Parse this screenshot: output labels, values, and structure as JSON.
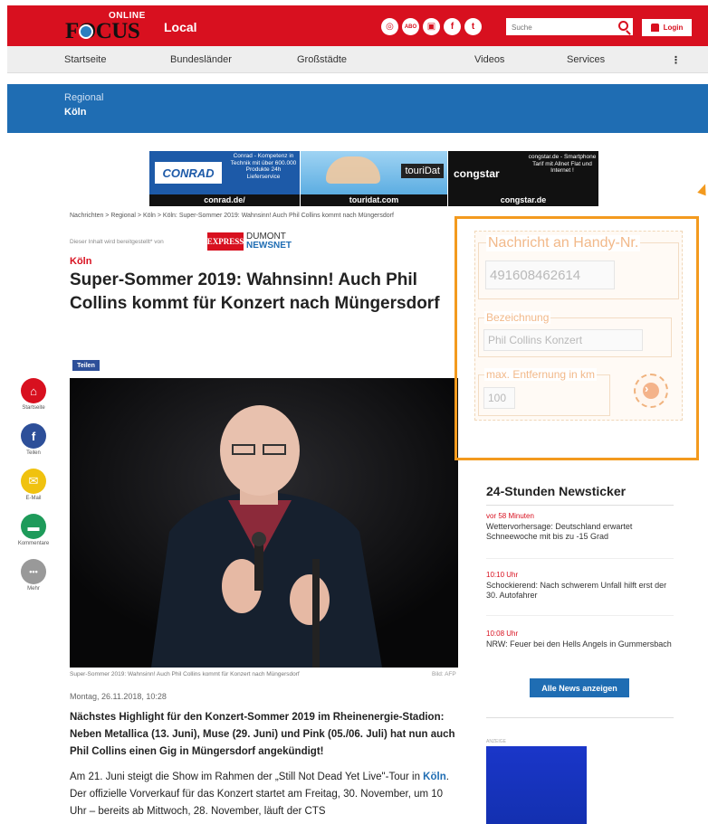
{
  "header": {
    "logo_top": "ONLINE",
    "logo_main": "FOCUS",
    "section": "Local",
    "social_icons": [
      "globe-icon",
      "abo-icon",
      "podcast-icon",
      "facebook-icon",
      "twitter-icon"
    ],
    "abo_label": "ABO",
    "search_placeholder": "Suche",
    "login_label": "Login"
  },
  "nav": {
    "items": [
      "Startseite",
      "Bundesländer",
      "Großstädte",
      "Videos",
      "Services"
    ],
    "more": "⋮"
  },
  "regional": {
    "kicker": "Regional",
    "city": "Köln"
  },
  "ads": {
    "conrad_logo": "CONRAD",
    "conrad_text": "Conrad - Kompetenz in Technik mit über 600.000 Produkte 24h Lieferservice",
    "conrad_url": "conrad.de/",
    "touri_logo": "touriDat",
    "touri_url": "touridat.com",
    "congstar_logo": "congstar",
    "congstar_text": "congstar.de - Smartphone Tarif mit Allnet Flat und Internet !",
    "congstar_url": "congstar.de"
  },
  "article": {
    "breadcrumb": "Nachrichten  >  Regional  >  Köln  >  Köln: Super-Sommer 2019: Wahnsinn! Auch Phil Collins kommt nach Müngersdorf",
    "provider_text": "Dieser Inhalt wird bereitgestellt* von",
    "provider_logo": "EXPRESS",
    "provider_brand_1": "DUMONT",
    "provider_brand_2": "NEWSNET",
    "kicker": "Köln",
    "headline": "Super-Sommer 2019: Wahnsinn! Auch Phil Collins kommt für Konzert nach Müngersdorf",
    "share_label": "Teilen",
    "caption": "Super-Sommer 2019: Wahnsinn! Auch Phil Collins kommt für Konzert nach Müngersdorf",
    "credit": "Bild: AFP",
    "date": "Montag, 26.11.2018, 10:28",
    "lead": "Nächstes Highlight für den Konzert-Sommer 2019 im Rheinenergie-Stadion: Neben Metallica (13. Juni), Muse (29. Juni) und Pink (05./06. Juli) hat nun auch Phil Collins einen Gig in Müngersdorf angekündigt!",
    "body_1": "Am 21. Juni steigt die Show im Rahmen der „Still Not Dead Yet Live\"-Tour in ",
    "body_link": "Köln",
    "body_2": ". Der offizielle Vorverkauf für das Konzert startet am Freitag, 30. November, um 10 Uhr – bereits ab Mittwoch, 28. November, läuft der CTS"
  },
  "rail": [
    {
      "icon": "home-icon",
      "label": "Startseite",
      "color": "#d8101f",
      "glyph": "⌂"
    },
    {
      "icon": "facebook-icon",
      "label": "Teilen",
      "color": "#2d4f99",
      "glyph": "f"
    },
    {
      "icon": "mail-icon",
      "label": "E-Mail",
      "color": "#f0c20f",
      "glyph": "✉"
    },
    {
      "icon": "comment-icon",
      "label": "Kommentare",
      "color": "#1e9b5a",
      "glyph": "▬"
    },
    {
      "icon": "more-icon",
      "label": "Mehr",
      "color": "#999999",
      "glyph": "•••"
    }
  ],
  "widget": {
    "phone_legend": "Nachricht an Handy-Nr.",
    "phone_value": "491608462614",
    "label_legend": "Bezeichnung",
    "label_value": "Phil Collins Konzert",
    "distance_legend": "max. Entfernung in km",
    "distance_value": "100",
    "submit_glyph": "›"
  },
  "ticker": {
    "title": "24-Stunden Newsticker",
    "items": [
      {
        "time": "vor 58 Minuten",
        "text": "Wettervorhersage: Deutschland erwartet Schneewoche mit bis zu -15 Grad"
      },
      {
        "time": "10:10 Uhr",
        "text": "Schockierend: Nach schwerem Unfall hilft erst der 30. Autofahrer"
      },
      {
        "time": "10:08 Uhr",
        "text": "NRW: Feuer bei den Hells Angels in Gummersbach"
      }
    ],
    "button": "Alle News anzeigen"
  },
  "sidebar_ad": {
    "label": "ANZEIGE"
  },
  "colors": {
    "brand_red": "#d8101f",
    "regional_blue": "#1f6db3",
    "widget_orange": "#f39a1e"
  }
}
